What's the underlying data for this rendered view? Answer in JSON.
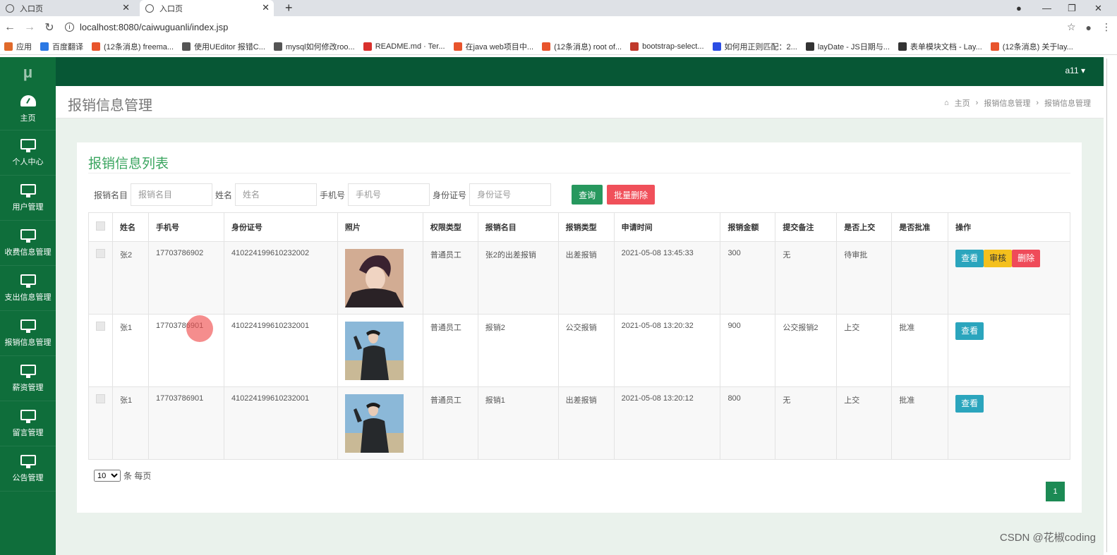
{
  "browser": {
    "tabs": [
      {
        "title": "入口页"
      },
      {
        "title": "入口页"
      }
    ],
    "url": "localhost:8080/caiwuguanli/index.jsp",
    "bookmarks": [
      {
        "label": "应用",
        "color": "#e06a2b"
      },
      {
        "label": "百度翻译",
        "color": "#2b78e4"
      },
      {
        "label": "(12条消息) freema...",
        "color": "#e8542c"
      },
      {
        "label": "使用UEditor 报错C...",
        "color": "#555555"
      },
      {
        "label": "mysql如何修改roo...",
        "color": "#555555"
      },
      {
        "label": "README.md · Ter...",
        "color": "#d9302c"
      },
      {
        "label": "在java web项目中...",
        "color": "#e8542c"
      },
      {
        "label": "(12条消息) root of...",
        "color": "#e8542c"
      },
      {
        "label": "bootstrap-select...",
        "color": "#c0392b"
      },
      {
        "label": "如何用正则匹配：2...",
        "color": "#2b4de4"
      },
      {
        "label": "layDate - JS日期与...",
        "color": "#333333"
      },
      {
        "label": "表单模块文档 - Lay...",
        "color": "#333333"
      },
      {
        "label": "(12条消息) 关于lay...",
        "color": "#e8542c"
      }
    ]
  },
  "app": {
    "logo": "μ",
    "user": "a11 ▾",
    "sidebar": [
      {
        "label": "主页",
        "icon": "dashboard-icon"
      },
      {
        "label": "个人中心",
        "icon": "monitor-icon"
      },
      {
        "label": "用户管理",
        "icon": "monitor-icon"
      },
      {
        "label": "收费信息管理",
        "icon": "monitor-icon"
      },
      {
        "label": "支出信息管理",
        "icon": "monitor-icon"
      },
      {
        "label": "报销信息管理",
        "icon": "monitor-icon"
      },
      {
        "label": "薪资管理",
        "icon": "monitor-icon"
      },
      {
        "label": "留言管理",
        "icon": "monitor-icon"
      },
      {
        "label": "公告管理",
        "icon": "monitor-icon"
      }
    ],
    "page_title": "报销信息管理",
    "breadcrumb": [
      "主页",
      "报销信息管理",
      "报销信息管理"
    ],
    "panel_title": "报销信息列表",
    "search": {
      "fields": [
        {
          "label": "报销名目",
          "placeholder": "报销名目"
        },
        {
          "label": "姓名",
          "placeholder": "姓名"
        },
        {
          "label": "手机号",
          "placeholder": "手机号"
        },
        {
          "label": "身份证号",
          "placeholder": "身份证号"
        }
      ],
      "query_label": "查询",
      "batch_delete_label": "批量删除"
    },
    "table": {
      "headers": [
        "姓名",
        "手机号",
        "身份证号",
        "照片",
        "权限类型",
        "报销名目",
        "报销类型",
        "申请时间",
        "报销金额",
        "提交备注",
        "是否上交",
        "是否批准",
        "操作"
      ],
      "rows": [
        {
          "name": "张2",
          "phone": "17703786902",
          "id_card": "410224199610232002",
          "role": "普通员工",
          "item": "张2的出差报销",
          "type": "出差报销",
          "time": "2021-05-08 13:45:33",
          "amount": "300",
          "remark": "无",
          "submitted": "待审批",
          "approved": "",
          "actions": [
            "查看",
            "审核",
            "删除"
          ]
        },
        {
          "name": "张1",
          "phone": "17703786901",
          "id_card": "410224199610232001",
          "role": "普通员工",
          "item": "报销2",
          "type": "公交报销",
          "time": "2021-05-08 13:20:32",
          "amount": "900",
          "remark": "公交报销2",
          "submitted": "上交",
          "approved": "批准",
          "actions": [
            "查看"
          ]
        },
        {
          "name": "张1",
          "phone": "17703786901",
          "id_card": "410224199610232001",
          "role": "普通员工",
          "item": "报销1",
          "type": "出差报销",
          "time": "2021-05-08 13:20:12",
          "amount": "800",
          "remark": "无",
          "submitted": "上交",
          "approved": "批准",
          "actions": [
            "查看"
          ]
        }
      ]
    },
    "pager": {
      "page_size": "10",
      "suffix": "条 每页",
      "current_page": "1"
    }
  },
  "watermark": "CSDN @花椒coding"
}
